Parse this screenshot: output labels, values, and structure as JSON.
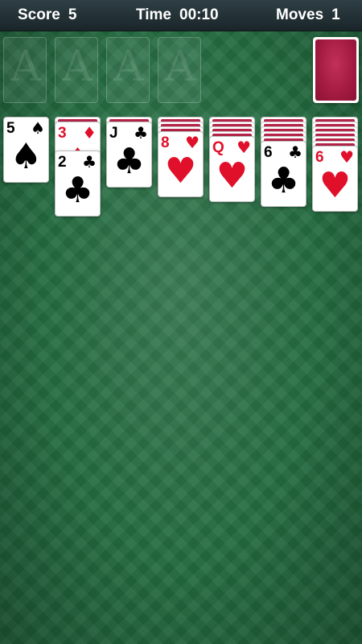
{
  "header": {
    "score_label": "Score",
    "score_value": "5",
    "time_label": "Time",
    "time_value": "00:10",
    "moves_label": "Moves",
    "moves_value": "1"
  },
  "foundations": [
    "A",
    "A",
    "A",
    "A"
  ],
  "colors": {
    "felt": "#236b3f",
    "card_back": "#a31a40",
    "red_suit": "#e0102a",
    "black_suit": "#000000"
  },
  "tableau": [
    {
      "face_down": 0,
      "face_up": [
        {
          "rank": "5",
          "suit": "spades-icon",
          "symbol": "♠",
          "color": "black"
        }
      ]
    },
    {
      "face_down": 1,
      "face_up": [
        {
          "rank": "3",
          "suit": "diamonds-icon",
          "symbol": "♦",
          "color": "red"
        },
        {
          "rank": "2",
          "suit": "clubs-icon",
          "symbol": "♣",
          "color": "black"
        }
      ]
    },
    {
      "face_down": 1,
      "face_up": [
        {
          "rank": "J",
          "suit": "clubs-icon",
          "symbol": "♣",
          "color": "black"
        }
      ]
    },
    {
      "face_down": 3,
      "face_up": [
        {
          "rank": "8",
          "suit": "hearts-icon",
          "symbol": "♥",
          "color": "red"
        }
      ]
    },
    {
      "face_down": 4,
      "face_up": [
        {
          "rank": "Q",
          "suit": "hearts-icon",
          "symbol": "♥",
          "color": "red"
        }
      ]
    },
    {
      "face_down": 5,
      "face_up": [
        {
          "rank": "6",
          "suit": "clubs-icon",
          "symbol": "♣",
          "color": "black"
        }
      ]
    },
    {
      "face_down": 6,
      "face_up": [
        {
          "rank": "6",
          "suit": "hearts-icon",
          "symbol": "♥",
          "color": "red"
        }
      ]
    }
  ]
}
